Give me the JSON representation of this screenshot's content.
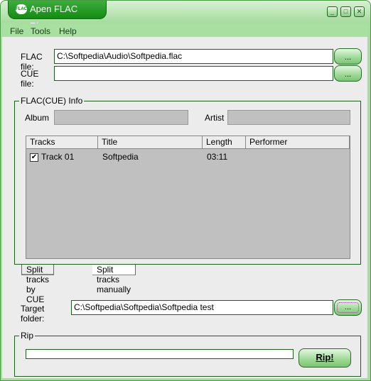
{
  "window": {
    "title": "Apen FLAC Ripper",
    "logo_text": "FLAC"
  },
  "menu": [
    {
      "label": "File"
    },
    {
      "label": "Tools"
    },
    {
      "label": "Help"
    }
  ],
  "flac_file": {
    "label": "FLAC file:",
    "value": "C:\\Softpedia\\Audio\\Softpedia.flac",
    "browse": "..."
  },
  "cue_file": {
    "label": "CUE file:",
    "value": "",
    "browse": "..."
  },
  "info": {
    "title": "FLAC(CUE) Info",
    "album_label": "Album",
    "album": "",
    "artist_label": "Artist",
    "artist": ""
  },
  "tracks": {
    "columns": [
      "Tracks",
      "Title",
      "Length",
      "Performer"
    ],
    "rows": [
      {
        "track": "Track 01",
        "title": "Softpedia",
        "length": "03:11",
        "performer": "",
        "checked": true
      }
    ]
  },
  "tabs": [
    {
      "label": "Split tracks by CUE",
      "active": true
    },
    {
      "label": "Split tracks manually",
      "active": false
    }
  ],
  "target": {
    "label": "Target folder:",
    "value": "C:\\Softpedia\\Softpedia\\Softpedia test",
    "browse": "..."
  },
  "rip": {
    "title": "Rip",
    "button": "Rip!",
    "progress": 0
  },
  "colors": {
    "accent": "#1a8a1a",
    "menubar": "#a8e0a0"
  }
}
